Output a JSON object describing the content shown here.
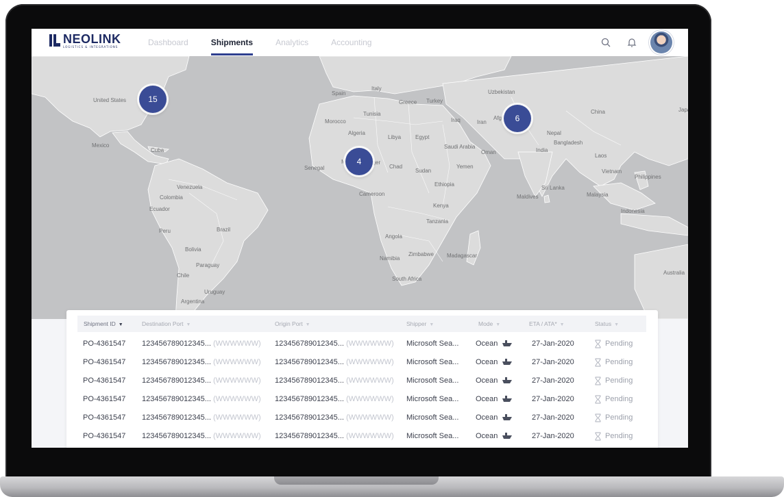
{
  "app": {
    "logo_text": "NEOLINK",
    "logo_subtitle": "LOGISTICS & INTEGRATIONS",
    "nav_tabs": [
      {
        "label": "Dashboard",
        "active": false
      },
      {
        "label": "Shipments",
        "active": true
      },
      {
        "label": "Analytics",
        "active": false
      },
      {
        "label": "Accounting",
        "active": false
      }
    ],
    "icons": {
      "search": "search-icon",
      "notifications": "bell-icon",
      "profile": "avatar"
    }
  },
  "colors": {
    "brand": "#1d2a63",
    "accent": "#2e3f8f",
    "cluster": "#3a4c96",
    "map_water": "#c2c3c5",
    "map_land": "#dcdcdc"
  },
  "map": {
    "labels": [
      "United States",
      "Mexico",
      "Cuba",
      "Venezuela",
      "Colombia",
      "Ecuador",
      "Peru",
      "Brazil",
      "Bolivia",
      "Paraguay",
      "Chile",
      "Uruguay",
      "Argentina",
      "Spain",
      "Italy",
      "Greece",
      "Turkey",
      "Tunisia",
      "Morocco",
      "Algeria",
      "Libya",
      "Egypt",
      "Iraq",
      "Iran",
      "Saudi Arabia",
      "Oman",
      "Yemen",
      "Mali",
      "Niger",
      "Chad",
      "Sudan",
      "Senegal",
      "Ethiopia",
      "Cameroon",
      "Kenya",
      "Tanzania",
      "Angola",
      "Zimbabwe",
      "Madagascar",
      "Namibia",
      "South Africa",
      "Uzbekistan",
      "Afghanistan",
      "Nepal",
      "Bangladesh",
      "India",
      "China",
      "Japan",
      "Laos",
      "Vietnam",
      "Philippines",
      "Sri Lanka",
      "Maldives",
      "Malaysia",
      "Indonesia",
      "Australia"
    ],
    "clusters": [
      {
        "count": "15",
        "region": "north-america"
      },
      {
        "count": "4",
        "region": "west-africa"
      },
      {
        "count": "6",
        "region": "south-asia"
      }
    ]
  },
  "table": {
    "columns": [
      {
        "label": "Shipment ID",
        "sortable": true,
        "sorted": true
      },
      {
        "label": "Destination Port",
        "sortable": true
      },
      {
        "label": "Origin Port",
        "sortable": true
      },
      {
        "label": "Shipper",
        "sortable": true
      },
      {
        "label": "Mode",
        "sortable": true
      },
      {
        "label": "ETA / ATA*",
        "sortable": true
      },
      {
        "label": "Status",
        "sortable": true
      }
    ],
    "rows": [
      {
        "id": "PO-4361547",
        "dest": "123456789012345...",
        "dest_code": "(WWWWWW)",
        "origin": "123456789012345...",
        "origin_code": "(WWWWWW)",
        "shipper": "Microsoft Sea...",
        "mode": "Ocean",
        "eta": "27-Jan-2020",
        "status": "Pending"
      },
      {
        "id": "PO-4361547",
        "dest": "123456789012345...",
        "dest_code": "(WWWWWW)",
        "origin": "123456789012345...",
        "origin_code": "(WWWWWW)",
        "shipper": "Microsoft Sea...",
        "mode": "Ocean",
        "eta": "27-Jan-2020",
        "status": "Pending"
      },
      {
        "id": "PO-4361547",
        "dest": "123456789012345...",
        "dest_code": "(WWWWWW)",
        "origin": "123456789012345...",
        "origin_code": "(WWWWWW)",
        "shipper": "Microsoft Sea...",
        "mode": "Ocean",
        "eta": "27-Jan-2020",
        "status": "Pending"
      },
      {
        "id": "PO-4361547",
        "dest": "123456789012345...",
        "dest_code": "(WWWWWW)",
        "origin": "123456789012345...",
        "origin_code": "(WWWWWW)",
        "shipper": "Microsoft Sea...",
        "mode": "Ocean",
        "eta": "27-Jan-2020",
        "status": "Pending"
      },
      {
        "id": "PO-4361547",
        "dest": "123456789012345...",
        "dest_code": "(WWWWWW)",
        "origin": "123456789012345...",
        "origin_code": "(WWWWWW)",
        "shipper": "Microsoft Sea...",
        "mode": "Ocean",
        "eta": "27-Jan-2020",
        "status": "Pending"
      },
      {
        "id": "PO-4361547",
        "dest": "123456789012345...",
        "dest_code": "(WWWWWW)",
        "origin": "123456789012345...",
        "origin_code": "(WWWWWW)",
        "shipper": "Microsoft Sea...",
        "mode": "Ocean",
        "eta": "27-Jan-2020",
        "status": "Pending"
      }
    ],
    "mode_icon": "ship-icon",
    "status_icon": "hourglass-icon"
  }
}
